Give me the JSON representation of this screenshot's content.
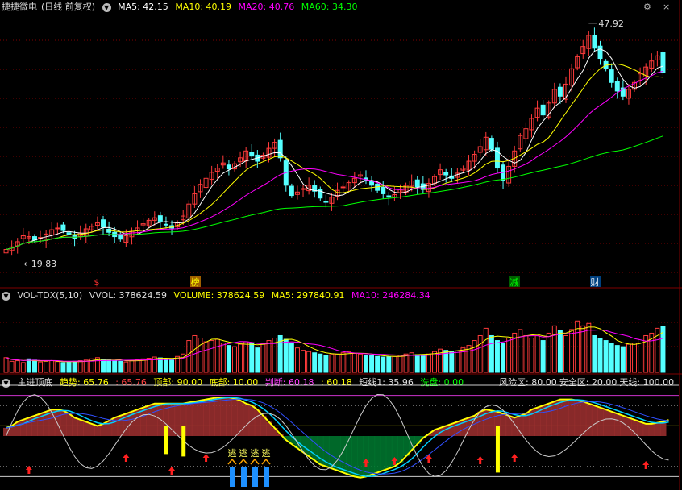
{
  "colors": {
    "up": "#ff3b3b",
    "down": "#54ffff",
    "ma5": "#ffffff",
    "ma10": "#ffff00",
    "ma20": "#ff00ff",
    "ma60": "#00ff00"
  },
  "price_panel": {
    "stock_name": "捷捷微电",
    "period": "(日线 前复权)",
    "ma5": "MA5: 42.15",
    "ma10": "MA10: 40.19",
    "ma20": "MA20: 40.76",
    "ma60": "MA60: 34.30",
    "high_label": "47.92",
    "low_label": "19.83",
    "markers": [
      "$",
      "榜",
      "减",
      "财"
    ],
    "buttons": [
      "⚙",
      "×"
    ]
  },
  "volume_panel": {
    "name": "VOL-TDX(5,10)",
    "vvol": "VVOL: 378624.59",
    "volume": "VOLUME: 378624.59",
    "ma5": "MA5: 297840.91",
    "ma10": "MA10: 246284.34"
  },
  "indicator_panel": {
    "name": "主进顶底",
    "trend": "趋势: 65.76",
    "trend2": ": 65.76",
    "top": "顶部: 90.00",
    "bottom": "底部: 10.00",
    "judge": "判断: 60.18",
    "judge2": ": 60.18",
    "short": "短线1: 35.96",
    "wash": "洗盘: 0.00",
    "risk": "风险区: 80.00",
    "safe": "安全区: 20.00",
    "sky": "天线: 100.00",
    "escape_labels": [
      "逃",
      "逃",
      "逃",
      "逃"
    ]
  },
  "chart_data": {
    "type": "candlestick",
    "price_high": 47.92,
    "price_low": 19.83,
    "close_series": [
      21.5,
      21.8,
      22.4,
      23.1,
      23.0,
      22.6,
      22.9,
      23.3,
      23.8,
      24.0,
      23.7,
      23.2,
      22.8,
      23.4,
      23.9,
      24.2,
      24.6,
      24.1,
      23.5,
      23.0,
      22.7,
      23.1,
      23.6,
      24.0,
      24.5,
      24.9,
      25.2,
      24.8,
      24.4,
      24.0,
      24.6,
      25.4,
      26.8,
      28.0,
      29.1,
      29.8,
      30.5,
      31.0,
      31.6,
      30.9,
      31.5,
      32.2,
      33.0,
      32.4,
      31.8,
      32.5,
      33.3,
      34.0,
      32.2,
      29.0,
      27.8,
      28.2,
      28.6,
      29.0,
      28.3,
      27.5,
      27.0,
      27.6,
      28.4,
      28.8,
      29.3,
      29.8,
      30.2,
      29.6,
      29.0,
      28.4,
      28.0,
      27.6,
      27.9,
      28.5,
      29.0,
      29.5,
      28.8,
      28.5,
      29.2,
      30.0,
      30.8,
      30.2,
      29.8,
      30.4,
      31.0,
      31.8,
      32.6,
      33.5,
      34.6,
      33.2,
      31.0,
      29.5,
      31.2,
      33.0,
      34.8,
      35.6,
      36.8,
      38.0,
      37.2,
      38.6,
      40.2,
      39.4,
      40.8,
      42.6,
      44.0,
      45.2,
      46.5,
      45.0,
      43.8,
      42.6,
      41.0,
      40.0,
      39.4,
      40.2,
      41.0,
      42.0,
      42.8,
      43.5,
      44.1,
      42.15
    ],
    "volume_max": 580000,
    "volume_series": [
      120000,
      90000,
      95000,
      80000,
      110000,
      100000,
      85000,
      90000,
      95000,
      88000,
      80000,
      82000,
      90000,
      95000,
      100000,
      110000,
      120000,
      105000,
      100000,
      95000,
      90000,
      85000,
      98000,
      105000,
      110000,
      115000,
      125000,
      118000,
      110000,
      100000,
      130000,
      150000,
      260000,
      300000,
      280000,
      250000,
      260000,
      270000,
      240000,
      220000,
      210000,
      230000,
      250000,
      240000,
      200000,
      230000,
      260000,
      280000,
      300000,
      270000,
      240000,
      200000,
      180000,
      170000,
      160000,
      150000,
      140000,
      145000,
      150000,
      160000,
      170000,
      155000,
      150000,
      140000,
      135000,
      130000,
      125000,
      128000,
      130000,
      140000,
      150000,
      160000,
      145000,
      140000,
      150000,
      170000,
      190000,
      180000,
      170000,
      175000,
      200000,
      220000,
      260000,
      300000,
      360000,
      300000,
      260000,
      240000,
      280000,
      320000,
      350000,
      300000,
      280000,
      300000,
      260000,
      320000,
      380000,
      340000,
      300000,
      350000,
      420000,
      380000,
      400000,
      300000,
      280000,
      260000,
      240000,
      220000,
      210000,
      230000,
      240000,
      280000,
      300000,
      320000,
      360000,
      378624
    ],
    "indicator_range": [
      0,
      100
    ],
    "trend_series": [
      58,
      60,
      64,
      66,
      68,
      70,
      72,
      74,
      76,
      76,
      75,
      72,
      68,
      66,
      64,
      62,
      60,
      62,
      65,
      68,
      70,
      72,
      74,
      76,
      78,
      80,
      82,
      82,
      82,
      82,
      82,
      82,
      83,
      84,
      85,
      86,
      87,
      88,
      88,
      88,
      87,
      85,
      82,
      80,
      76,
      70,
      64,
      58,
      52,
      46,
      42,
      38,
      34,
      30,
      26,
      22,
      20,
      18,
      16,
      14,
      12,
      10,
      9,
      10,
      12,
      14,
      16,
      18,
      20,
      24,
      30,
      36,
      42,
      48,
      52,
      56,
      58,
      60,
      62,
      64,
      66,
      68,
      70,
      74,
      76,
      75,
      74,
      72,
      70,
      68,
      70,
      72,
      76,
      78,
      80,
      82,
      84,
      86,
      86,
      86,
      85,
      84,
      82,
      80,
      78,
      76,
      74,
      72,
      70,
      68,
      66,
      64,
      62,
      62,
      63,
      64,
      65.76
    ]
  }
}
